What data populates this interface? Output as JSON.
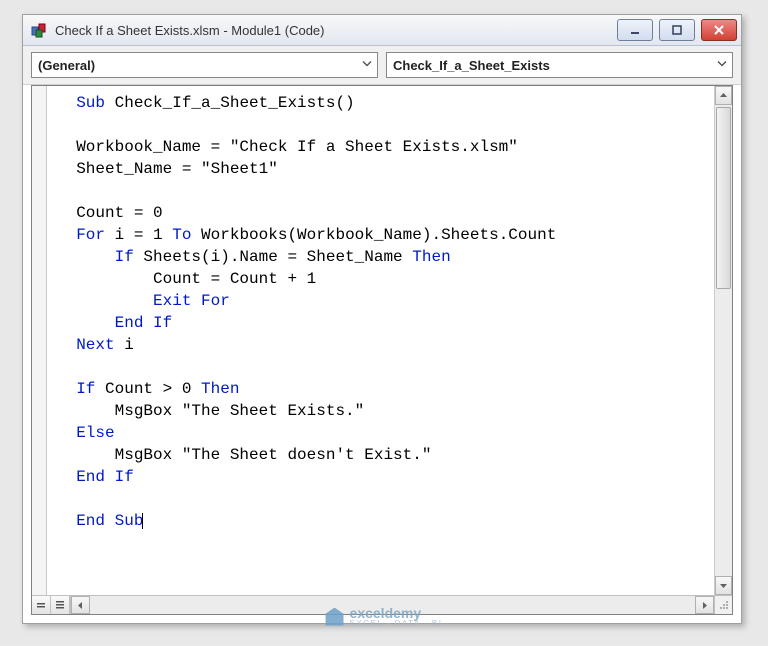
{
  "window": {
    "title": "Check If a Sheet Exists.xlsm - Module1 (Code)"
  },
  "dropdowns": {
    "left": "(General)",
    "right": "Check_If_a_Sheet_Exists"
  },
  "code": {
    "l01_kw": "Sub",
    "l01_rest": " Check_If_a_Sheet_Exists()",
    "l03": "Workbook_Name = \"Check If a Sheet Exists.xlsm\"",
    "l04": "Sheet_Name = \"Sheet1\"",
    "l06": "Count = 0",
    "l07_kw1": "For",
    "l07_mid": " i = 1 ",
    "l07_kw2": "To",
    "l07_rest": " Workbooks(Workbook_Name).Sheets.Count",
    "l08_kw": "If",
    "l08_mid": " Sheets(i).Name = Sheet_Name ",
    "l08_kw2": "Then",
    "l09": "Count = Count + 1",
    "l10_kw": "Exit For",
    "l11_kw": "End If",
    "l12_kw": "Next",
    "l12_rest": " i",
    "l14_kw": "If",
    "l14_mid": " Count > 0 ",
    "l14_kw2": "Then",
    "l15": "MsgBox \"The Sheet Exists.\"",
    "l16_kw": "Else",
    "l17": "MsgBox \"The Sheet doesn't Exist.\"",
    "l18_kw": "End If",
    "l20_kw": "End Sub"
  },
  "watermark": {
    "brand": "exceldemy",
    "tag": "EXCEL · DATA · BI"
  }
}
